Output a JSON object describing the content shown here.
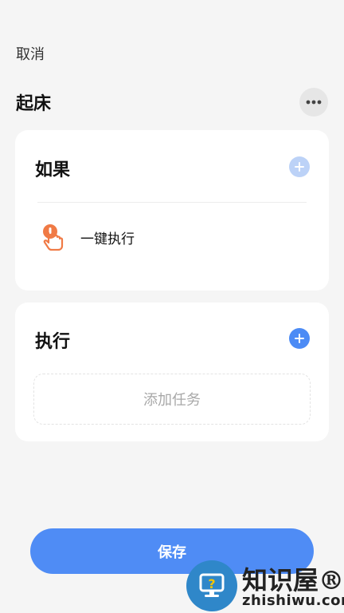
{
  "header": {
    "cancel_label": "取消",
    "title": "起床",
    "more_icon": "more-horizontal-icon"
  },
  "if_card": {
    "title": "如果",
    "trigger_icon": "hand-tap-icon",
    "trigger_label": "一键执行",
    "add_icon": "plus-icon"
  },
  "do_card": {
    "title": "执行",
    "add_task_label": "添加任务",
    "add_icon": "plus-icon"
  },
  "footer": {
    "save_label": "保存"
  },
  "watermark": {
    "name": "知识屋®",
    "url": "zhishiwu.com"
  },
  "colors": {
    "accent": "#4f8cf5",
    "accent_disabled": "#bcd2f7",
    "background": "#f5f5f5",
    "card": "#ffffff",
    "hand_orange": "#f07a45"
  }
}
